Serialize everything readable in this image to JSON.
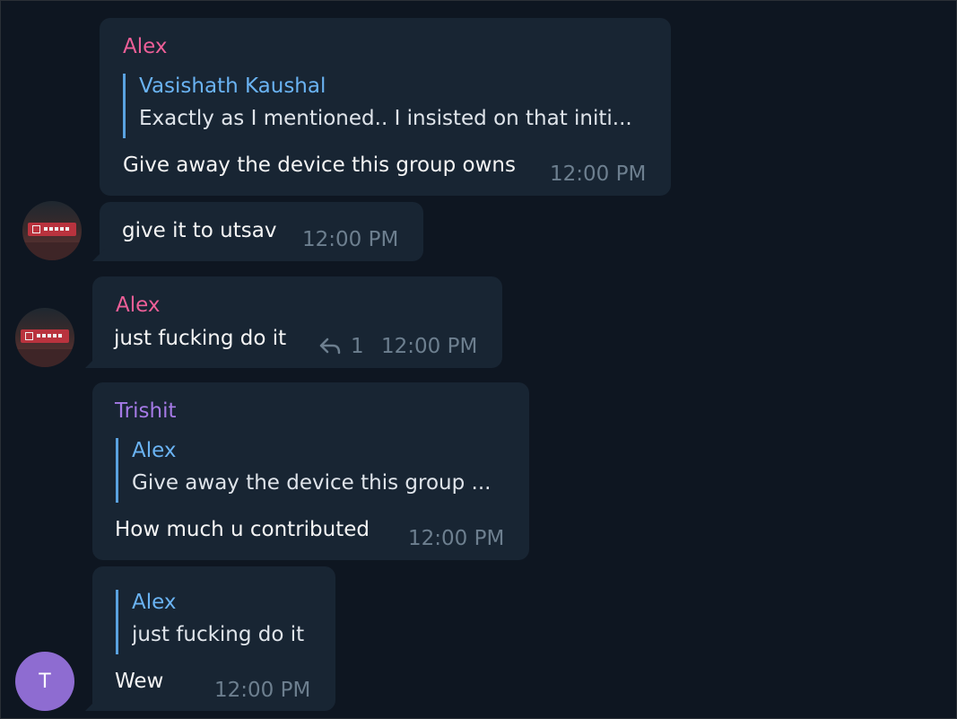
{
  "colors": {
    "background": "#0e1621",
    "bubble": "#182533",
    "alex_name": "#ee5f98",
    "trishit_name": "#a57ae6",
    "reply_accent": "#6ab3f3",
    "timestamp": "#6d7f8f",
    "letter_avatar": "#8e6cd1"
  },
  "messages": [
    {
      "sender": "Alex",
      "reply_to": {
        "name": "Vasishath Kaushal",
        "text": "Exactly as I mentioned.. I insisted on that initi..."
      },
      "text": "Give away the device this group owns",
      "time": "12:00 PM"
    },
    {
      "text": "give it to utsav",
      "time": "12:00 PM",
      "avatar_icon": "profile-photo"
    },
    {
      "sender": "Alex",
      "text": "just fucking do it",
      "reply_icon": "reply-arrow-icon",
      "reply_count": "1",
      "time": "12:00 PM",
      "avatar_icon": "profile-photo"
    },
    {
      "sender": "Trishit",
      "reply_to": {
        "name": "Alex",
        "text": "Give away the device this group ..."
      },
      "text": "How much u contributed",
      "time": "12:00 PM"
    },
    {
      "reply_to": {
        "name": "Alex",
        "text": "just fucking do it"
      },
      "text": "Wew",
      "time": "12:00 PM",
      "avatar_letter": "T"
    }
  ]
}
